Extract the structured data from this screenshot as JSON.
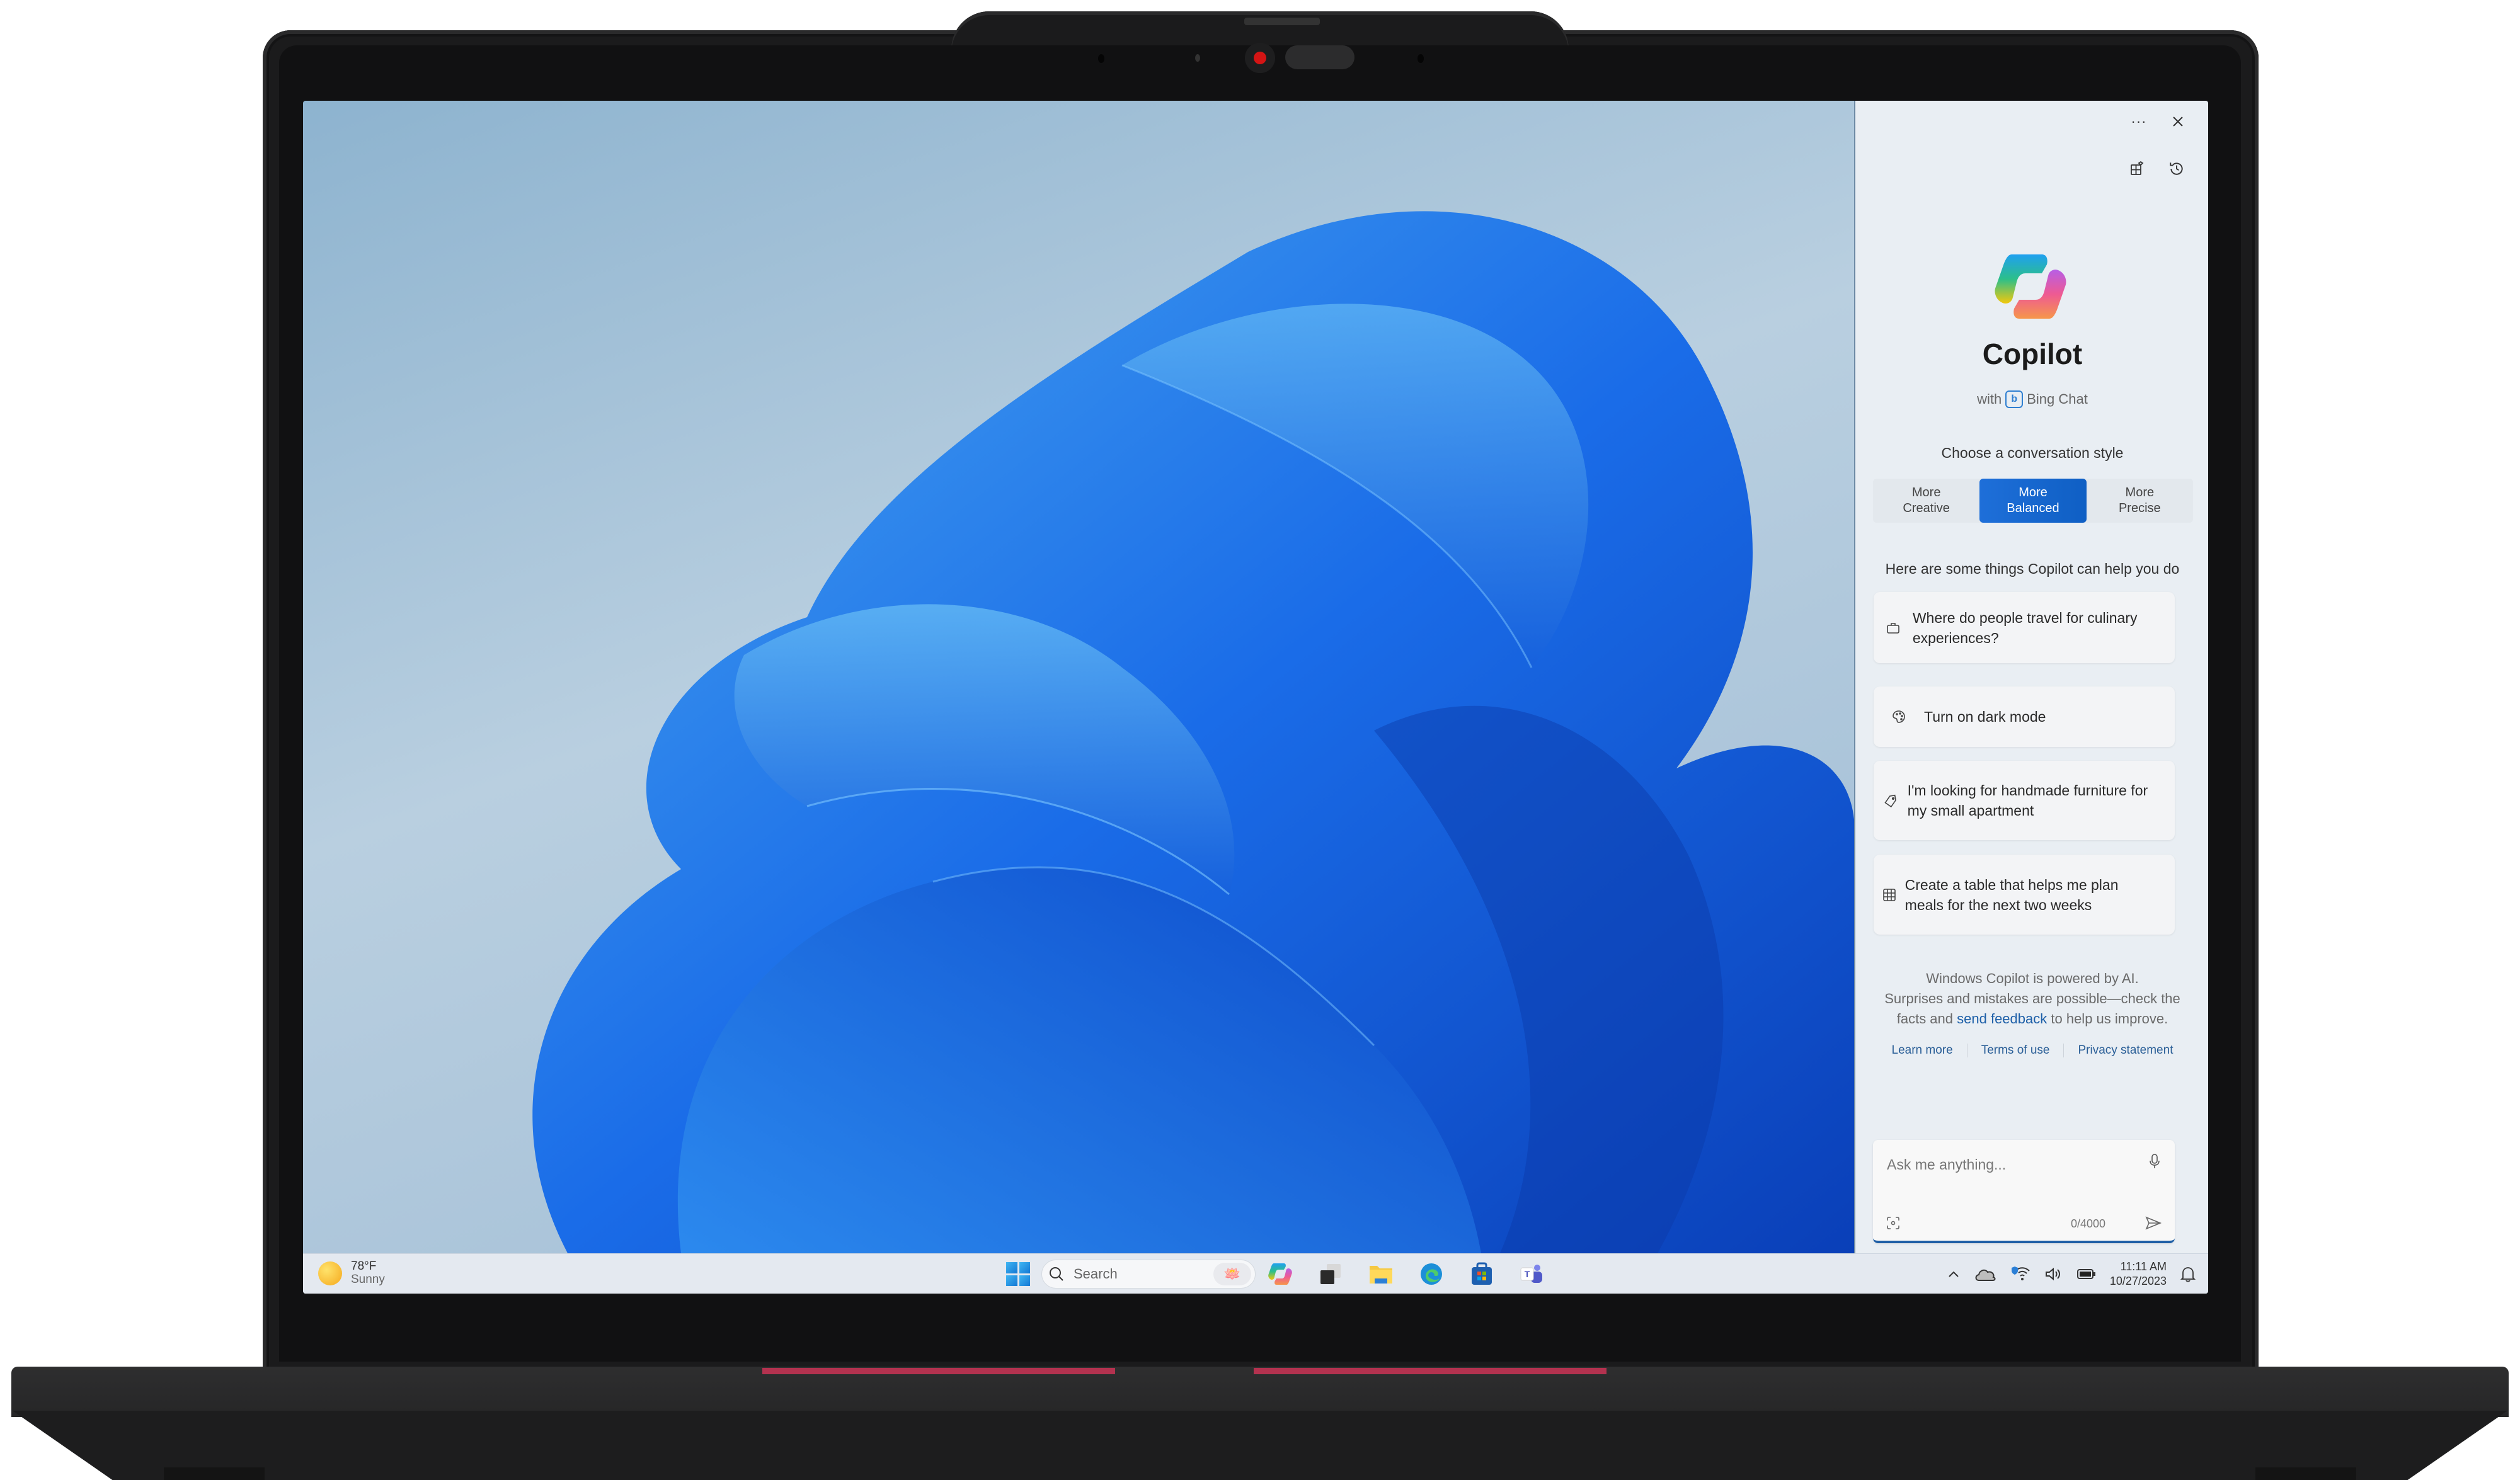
{
  "copilot": {
    "menu_icon": "more-icon",
    "close_icon": "close-icon",
    "plugins_icon": "plugins-icon",
    "history_icon": "history-icon",
    "title": "Copilot",
    "subtitle_prefix": "with",
    "subtitle_brand": "Bing Chat",
    "style_label": "Choose a conversation style",
    "styles": [
      {
        "line1": "More",
        "line2": "Creative",
        "active": false
      },
      {
        "line1": "More",
        "line2": "Balanced",
        "active": true
      },
      {
        "line1": "More",
        "line2": "Precise",
        "active": false
      }
    ],
    "help_label": "Here are some things Copilot can help you do",
    "suggestions": [
      {
        "icon": "briefcase-icon",
        "text": "Where do people travel for culinary experiences?"
      },
      {
        "icon": "palette-icon",
        "text": "Turn on dark mode"
      },
      {
        "icon": "tag-icon",
        "text": "I'm looking for handmade furniture for my small apartment"
      },
      {
        "icon": "table-icon",
        "text": "Create a table that helps me plan meals for the next two weeks"
      }
    ],
    "disclaimer": {
      "line1": "Windows Copilot is powered by AI.",
      "line2_prefix": "Surprises and mistakes are possible—check the facts and",
      "feedback_link": "send feedback",
      "line2_suffix": "to help us improve."
    },
    "links": [
      "Learn more",
      "Terms of use",
      "Privacy statement"
    ],
    "input": {
      "placeholder": "Ask me anything...",
      "value": "",
      "counter": "0/4000"
    },
    "accent_color": "#1e6fd9"
  },
  "taskbar": {
    "weather": {
      "temp": "78°F",
      "condition": "Sunny"
    },
    "search_placeholder": "Search",
    "apps": [
      "copilot",
      "task-view",
      "file-explorer",
      "edge",
      "microsoft-store",
      "teams"
    ],
    "clock": {
      "time": "11:11 AM",
      "date": "10/27/2023"
    }
  }
}
